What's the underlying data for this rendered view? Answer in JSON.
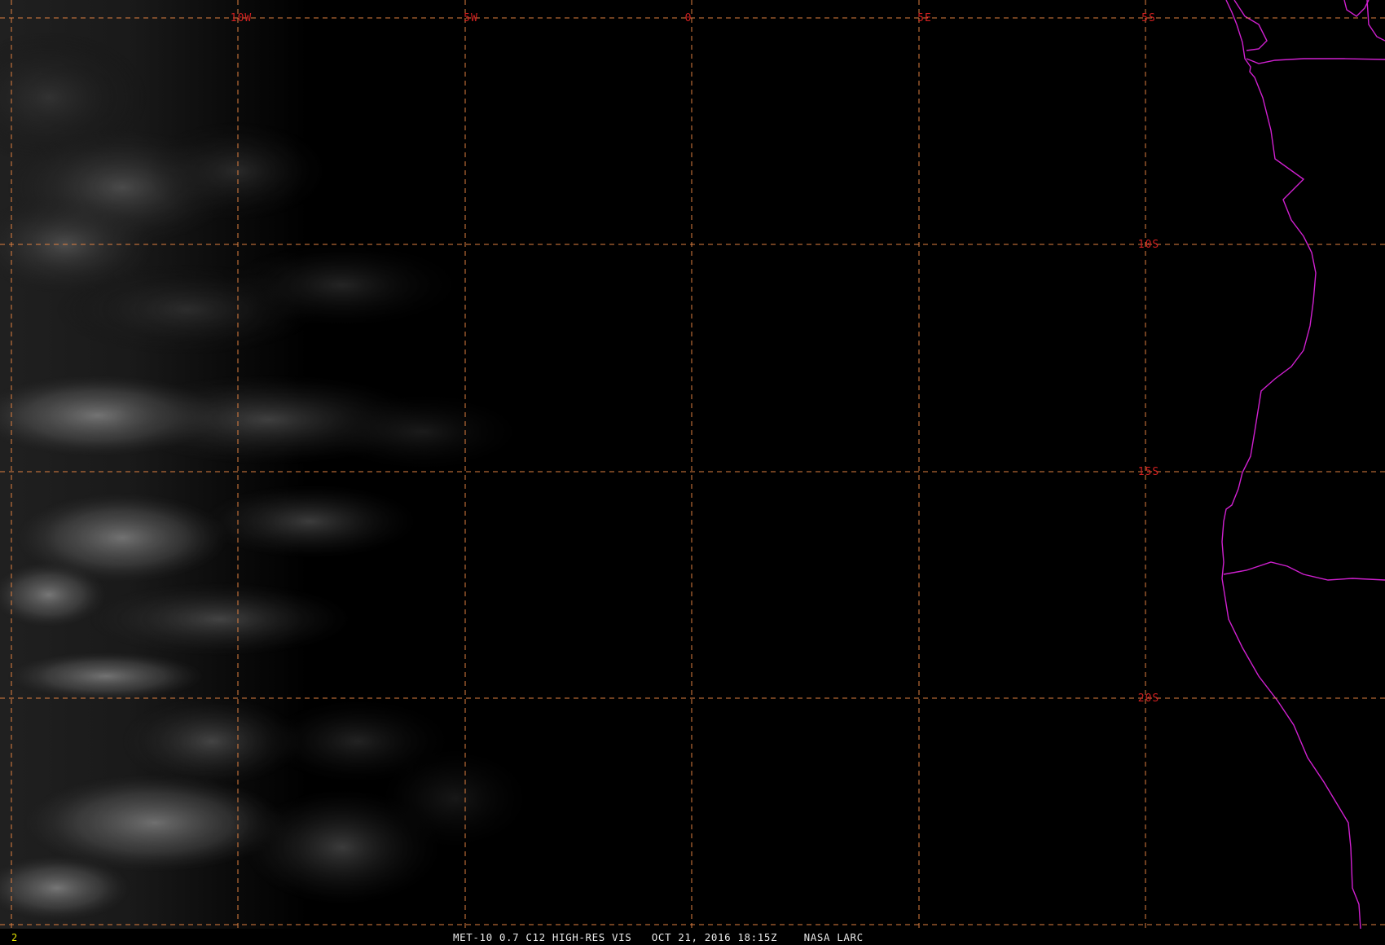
{
  "grid": {
    "longitude_labels": [
      "10W",
      "5W",
      "0",
      "5E"
    ],
    "latitude_labels": [
      "5S",
      "10S",
      "15S",
      "20S"
    ],
    "line_color": "#e08040",
    "label_color": "#d02020"
  },
  "map": {
    "boundary_color": "#d020d0",
    "background_color": "#000000"
  },
  "status": {
    "frame_number": "2",
    "caption": "MET-10 0.7 C12 HIGH-RES VIS   OCT 21, 2016 18:15Z    NASA LARC"
  }
}
